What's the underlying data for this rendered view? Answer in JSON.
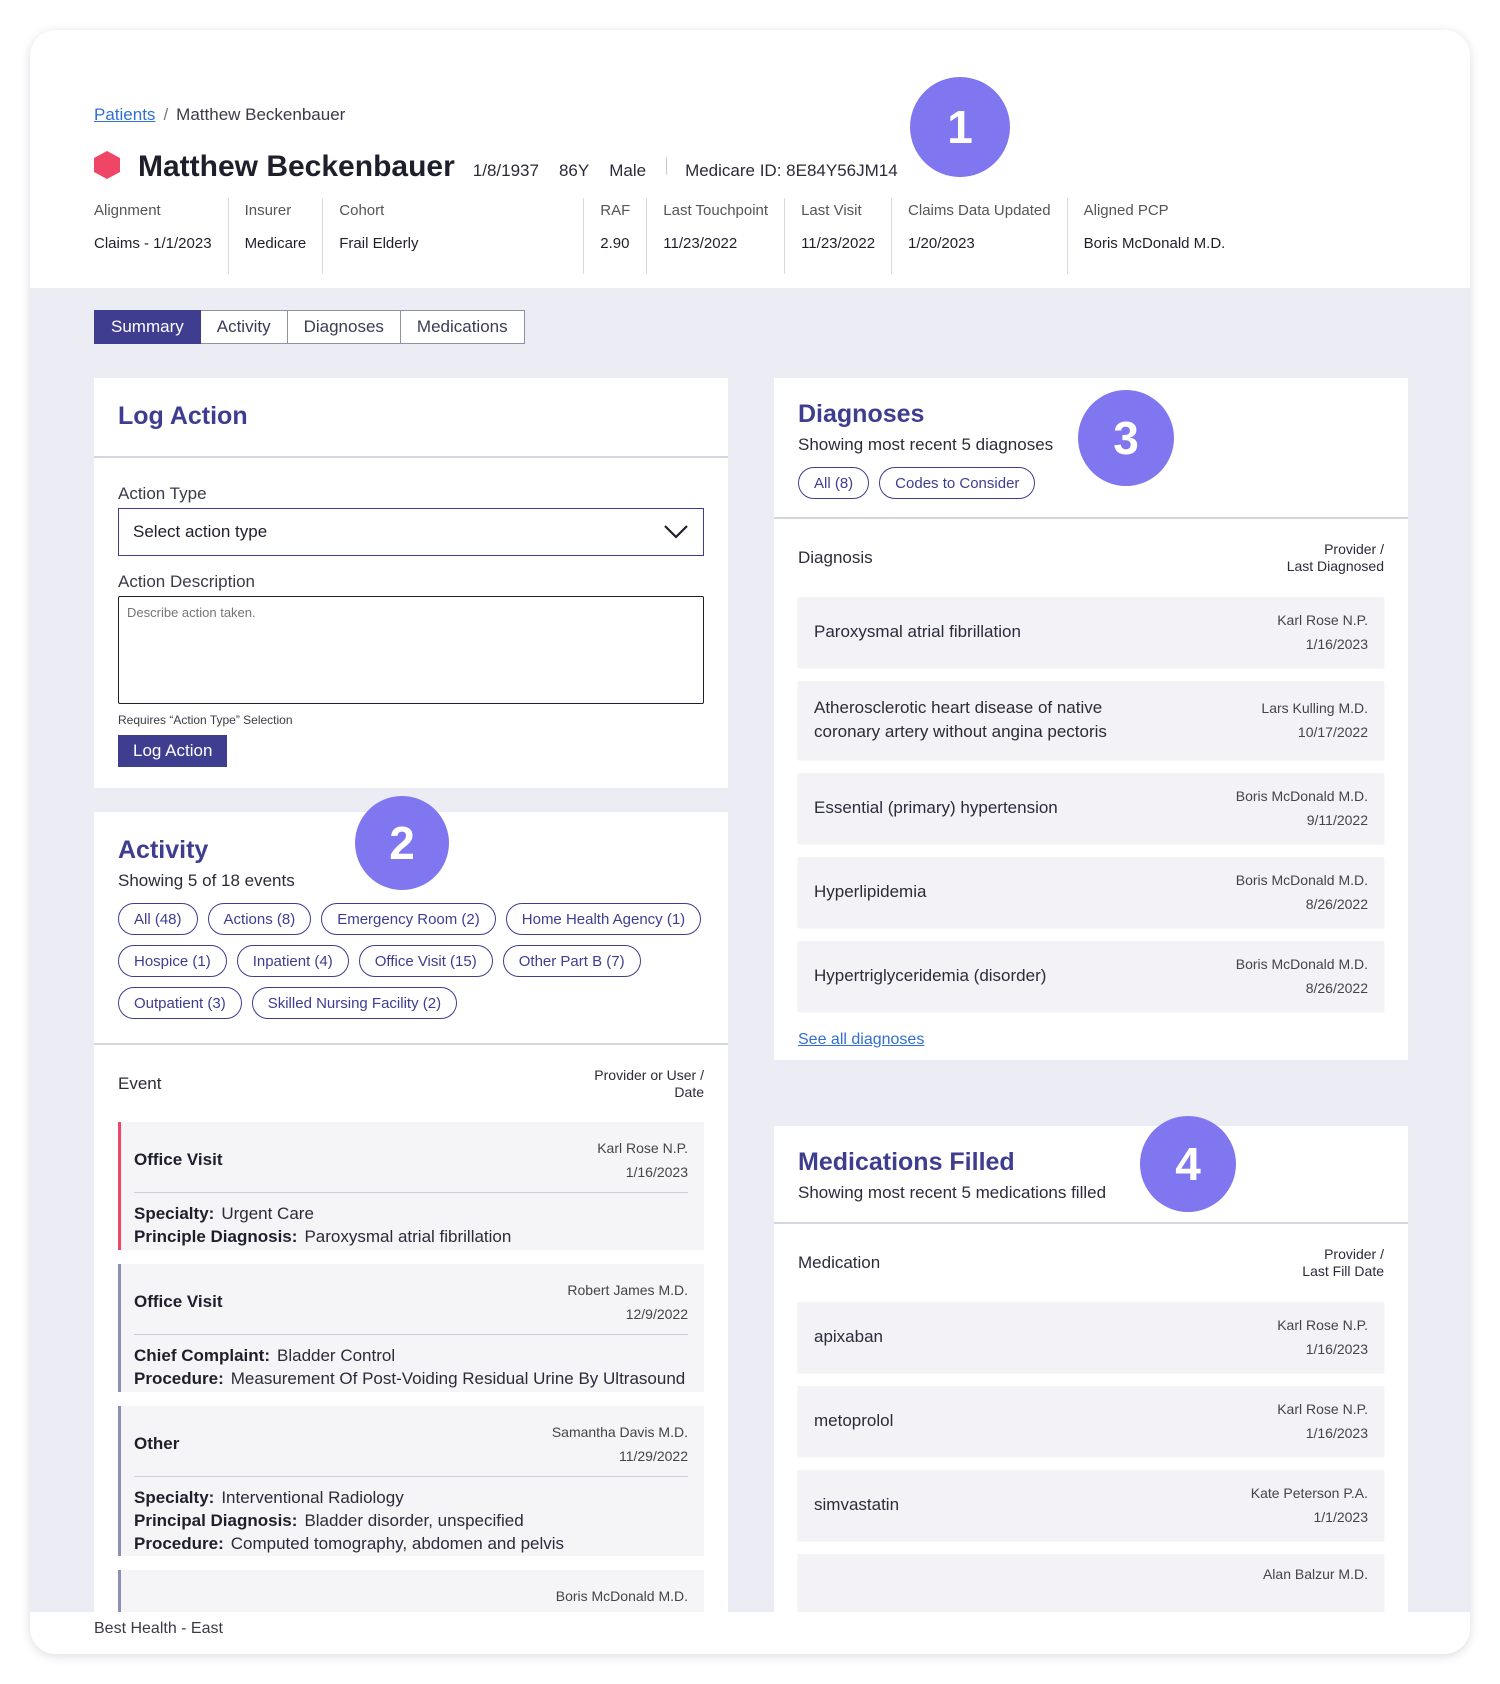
{
  "breadcrumb": {
    "link": "Patients",
    "sep": "/",
    "current": "Matthew Beckenbauer"
  },
  "patient": {
    "name": "Matthew Beckenbauer",
    "dob": "1/8/1937",
    "age": "86Y",
    "sex": "Male",
    "medicare_id": "Medicare ID: 8E84Y56JM14"
  },
  "stats": [
    {
      "label": "Alignment",
      "value": "Claims - 1/1/2023"
    },
    {
      "label": "Insurer",
      "value": "Medicare"
    },
    {
      "label": "Cohort",
      "value": "Frail Elderly"
    },
    {
      "label": "RAF",
      "value": "2.90"
    },
    {
      "label": "Last Touchpoint",
      "value": "11/23/2022"
    },
    {
      "label": "Last Visit",
      "value": "11/23/2022"
    },
    {
      "label": "Claims Data Updated",
      "value": "1/20/2023"
    },
    {
      "label": "Aligned PCP",
      "value": "Boris McDonald M.D."
    }
  ],
  "badges": [
    "1",
    "2",
    "3",
    "4"
  ],
  "tabs": [
    "Summary",
    "Activity",
    "Diagnoses",
    "Medications"
  ],
  "log_action": {
    "title": "Log Action",
    "type_label": "Action Type",
    "type_value": "Select action type",
    "desc_label": "Action Description",
    "desc_placeholder": "Describe action taken.",
    "helper": "Requires “Action Type” Selection",
    "button": "Log Action"
  },
  "activity": {
    "title": "Activity",
    "subtitle": "Showing 5 of 18 events",
    "filters": [
      "All (48)",
      "Actions (8)",
      "Emergency Room (2)",
      "Home Health Agency (1)",
      "Hospice (1)",
      "Inpatient (4)",
      "Office Visit (15)",
      "Other Part B (7)",
      "Outpatient (3)",
      "Skilled Nursing Facility (2)"
    ],
    "col_left": "Event",
    "col_right_1": "Provider or User /",
    "col_right_2": "Date",
    "events": [
      {
        "type": "Office Visit",
        "provider": "Karl Rose N.P.",
        "date": "1/16/2023",
        "details": [
          {
            "k": "Specialty:",
            "v": "Urgent Care"
          },
          {
            "k": "Principle Diagnosis:",
            "v": "Paroxysmal atrial fibrillation"
          }
        ]
      },
      {
        "type": "Office Visit",
        "provider": "Robert James M.D.",
        "date": "12/9/2022",
        "details": [
          {
            "k": "Chief Complaint:",
            "v": "Bladder Control"
          },
          {
            "k": "Procedure:",
            "v": "Measurement Of Post-Voiding Residual Urine By Ultrasound"
          }
        ]
      },
      {
        "type": "Other",
        "provider": "Samantha Davis M.D.",
        "date": "11/29/2022",
        "details": [
          {
            "k": "Specialty:",
            "v": "Interventional Radiology"
          },
          {
            "k": "Principal Diagnosis:",
            "v": "Bladder disorder, unspecified"
          },
          {
            "k": "Procedure:",
            "v": "Computed tomography, abdomen and pelvis"
          }
        ]
      },
      {
        "type": "",
        "provider": "Boris McDonald M.D.",
        "date": "",
        "details": []
      }
    ]
  },
  "diagnoses": {
    "title": "Diagnoses",
    "subtitle": "Showing most recent 5 diagnoses",
    "filters": [
      "All (8)",
      "Codes to Consider"
    ],
    "col_left": "Diagnosis",
    "col_right_1": "Provider /",
    "col_right_2": "Last Diagnosed",
    "items": [
      {
        "name": "Paroxysmal atrial fibrillation",
        "provider": "Karl Rose N.P.",
        "date": "1/16/2023"
      },
      {
        "name": "Atherosclerotic heart disease of native coronary artery without angina pectoris",
        "provider": "Lars Kulling M.D.",
        "date": "10/17/2022"
      },
      {
        "name": "Essential (primary) hypertension",
        "provider": "Boris McDonald M.D.",
        "date": "9/11/2022"
      },
      {
        "name": "Hyperlipidemia",
        "provider": "Boris McDonald M.D.",
        "date": "8/26/2022"
      },
      {
        "name": "Hypertriglyceridemia (disorder)",
        "provider": "Boris McDonald M.D.",
        "date": "8/26/2022"
      }
    ],
    "see_all": "See all diagnoses"
  },
  "medications": {
    "title": "Medications Filled",
    "subtitle": "Showing most recent 5 medications filled",
    "col_left": "Medication",
    "col_right_1": "Provider /",
    "col_right_2": "Last Fill Date",
    "items": [
      {
        "name": "apixaban",
        "provider": "Karl Rose N.P.",
        "date": "1/16/2023"
      },
      {
        "name": "metoprolol",
        "provider": "Karl Rose N.P.",
        "date": "1/16/2023"
      },
      {
        "name": "simvastatin",
        "provider": "Kate Peterson P.A.",
        "date": "1/1/2023"
      },
      {
        "name": "",
        "provider": "Alan Balzur M.D.",
        "date": ""
      }
    ]
  },
  "footer": "Best Health - East",
  "colors": {
    "accent": "#3f3d8f",
    "badge": "#7f76f0",
    "alert": "#ef4566",
    "link": "#2f6fd6"
  }
}
